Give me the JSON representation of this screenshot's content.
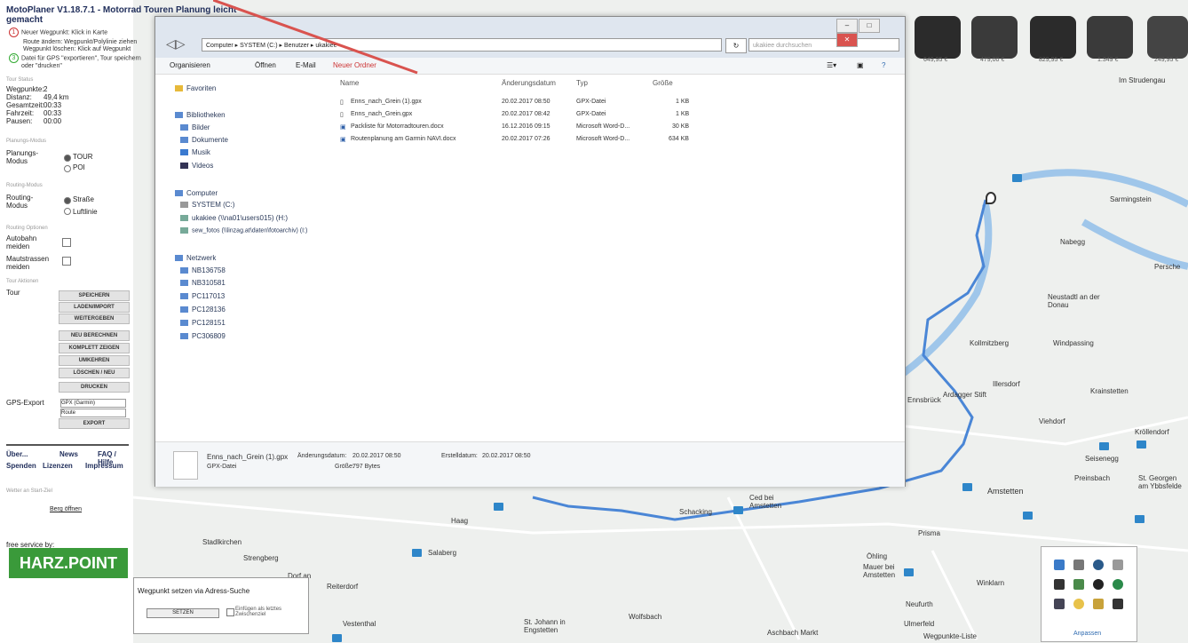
{
  "app": {
    "title": "MotoPlaner V1.18.7.1 - Motorrad Touren Planung leicht gemacht",
    "steps": [
      {
        "num": "1",
        "text": "Neuer Wegpunkt: Klick in Karte"
      },
      {
        "num": "2",
        "text": "Route ändern: Wegpunkt/Polylinie ziehen"
      },
      {
        "num": "",
        "text": "Wegpunkt löschen: Klick auf Wegpunkt"
      },
      {
        "num": "3",
        "text": "Datei für GPS \"exportieren\", Tour speichern"
      },
      {
        "num": "",
        "text": "oder \"drucken\""
      }
    ]
  },
  "stats": {
    "section": "Tour Status",
    "rows": [
      {
        "k": "Wegpunkte:",
        "v": "2"
      },
      {
        "k": "Distanz:",
        "v": "49,4 km"
      },
      {
        "k": "Gesamtzeit:",
        "v": "00:33"
      },
      {
        "k": "Fahrzeit:",
        "v": "00:33"
      },
      {
        "k": "Pausen:",
        "v": "00:00"
      }
    ]
  },
  "planning": {
    "section": "Planungs-Modus",
    "label": "Planungs-Modus",
    "options": [
      "TOUR",
      "POI"
    ]
  },
  "routing": {
    "section": "Routing-Modus",
    "label": "Routing-Modus",
    "options": [
      "Straße",
      "Luftlinie"
    ]
  },
  "avoid": {
    "section": "Routing Optionen",
    "items": [
      "Autobahn meiden",
      "Mautstrassen meiden"
    ]
  },
  "tour": {
    "section": "Tour Aktionen",
    "label": "Tour",
    "buttons": [
      "SPEICHERN",
      "LADEN/IMPORT",
      "WEITERGEBEN",
      "NEU BERECHNEN",
      "KOMPLETT ZEIGEN",
      "UMKEHREN",
      "LÖSCHEN / NEU",
      "DRUCKEN"
    ]
  },
  "gps": {
    "label": "GPS-Export",
    "format": "GPX (Garmin)",
    "type": "Route",
    "button": "EXPORT"
  },
  "links": {
    "row1": [
      "Über...",
      "News",
      "FAQ / Hilfe"
    ],
    "row2": [
      "Spenden",
      "Lizenzen",
      "Impressum"
    ]
  },
  "weather": {
    "label": "Wetter an Start-Ziel",
    "link": "Berg öffnen"
  },
  "sponsor": {
    "label": "free service by:",
    "logo": "HARZ.POINT"
  },
  "dialog": {
    "path": [
      "Computer",
      "SYSTEM (C:)",
      "Benutzer",
      "ukakiee"
    ],
    "search_placeholder": "ukakiee durchsuchen",
    "toolbar": [
      "Organisieren",
      "Öffnen",
      "E-Mail",
      "Neuer Ordner"
    ],
    "nav_favorites": "Favoriten",
    "nav_libraries": "Bibliotheken",
    "libraries": [
      "Bilder",
      "Dokumente",
      "Musik",
      "Videos"
    ],
    "nav_computer": "Computer",
    "drives": [
      "SYSTEM (C:)",
      "ukakiee (\\\\na01\\users015) (H:)",
      "sew_fotos (\\\\linzag.at\\daten\\fotoarchiv) (I:)"
    ],
    "nav_network": "Netzwerk",
    "network": [
      "NB136758",
      "NB310581",
      "PC117013",
      "PC128136",
      "PC128151",
      "PC306809"
    ],
    "columns": [
      "Name",
      "Änderungsdatum",
      "Typ",
      "Größe"
    ],
    "files": [
      {
        "name": "Enns_nach_Grein (1).gpx",
        "date": "20.02.2017 08:50",
        "type": "GPX-Datei",
        "size": "1 KB"
      },
      {
        "name": "Enns_nach_Grein.gpx",
        "date": "20.02.2017 08:42",
        "type": "GPX-Datei",
        "size": "1 KB"
      },
      {
        "name": "Packliste für Motorradtouren.docx",
        "date": "16.12.2016 09:15",
        "type": "Microsoft Word-D...",
        "size": "30 KB"
      },
      {
        "name": "Routenplanung am Garmin NAVI.docx",
        "date": "20.02.2017 07:26",
        "type": "Microsoft Word-D...",
        "size": "634 KB"
      }
    ],
    "status": {
      "name": "Enns_nach_Grein (1).gpx",
      "mod_label": "Änderungsdatum:",
      "mod": "20.02.2017 08:50",
      "created_label": "Erstelldatum:",
      "created": "20.02.2017 08:50",
      "type": "GPX-Datei",
      "size_label": "Größe:",
      "size": "797 Bytes"
    }
  },
  "ads": {
    "prices": [
      "649,95 €",
      "479,00 €",
      "829,95 €",
      "1.349 €",
      "249,95 €"
    ]
  },
  "map_places": [
    "Im Strudengau",
    "Sarmingstein",
    "Nabegg",
    "Persche",
    "Neustadtl an der Donau",
    "Kollmitzberg",
    "Windpassing",
    "Ardagger Stift",
    "Illersdorf",
    "Krainstetten",
    "Viehdorf",
    "Kröllendorf",
    "Seisenegg",
    "Preinsbach",
    "Amstetten",
    "St. Georgen am Ybbsfelde",
    "Ced bei Amstetten",
    "Schacking",
    "Haag",
    "Stadlkirchen",
    "Strengberg",
    "Salaberg",
    "Dorf an der Enns",
    "Reiterdorf",
    "Öhling",
    "Mauer bei Amstetten",
    "Winklarn",
    "Neufurth",
    "Vestenthal",
    "St. Johann in Engstetten",
    "Wolfsbach",
    "Aschbach Markt",
    "Ulmerfeld",
    "Prisma",
    "Ennsbrück"
  ],
  "address_search": {
    "title": "Wegpunkt setzen via Adress-Suche",
    "button": "SETZEN",
    "checkbox": "Einfügen als letztes Zwischenziel"
  },
  "icon_panel": {
    "link": "Anpassen"
  },
  "waypoint_list": "Wegpunkte-Liste",
  "colors": {
    "route": "#4a86d6",
    "marker": "#2e86c9",
    "accent": "#1f2d5a",
    "river": "#9fc6ea"
  }
}
